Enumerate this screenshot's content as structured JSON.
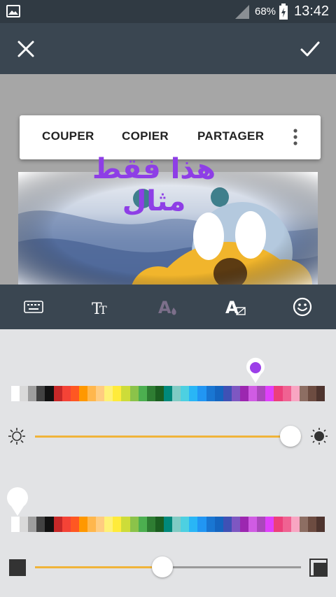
{
  "status_bar": {
    "battery": "68%",
    "time": "13:42",
    "icons": [
      "gallery-icon",
      "signal-icon",
      "battery-charging-icon"
    ]
  },
  "app_bar": {
    "icons": [
      "close-icon",
      "check-icon"
    ]
  },
  "popup_menu": {
    "cut_label": "COUPER",
    "copy_label": "COPIER",
    "share_label": "PARTAGER",
    "more_icon": "more-vert-icon"
  },
  "canvas": {
    "overlay_text": "هذا فقط مثال",
    "overlay_text_color": "#8e3ee6"
  },
  "toolbar": {
    "tools": [
      "keyboard-icon",
      "text-size-icon",
      "text-color-icon",
      "text-background-icon",
      "emoji-icon"
    ]
  },
  "palette": {
    "colors": [
      "#ffffff",
      "#d9d9d9",
      "#9e9e9e",
      "#424242",
      "#111111",
      "#c62828",
      "#f44336",
      "#ff5722",
      "#ff9800",
      "#ffb74d",
      "#ffcc80",
      "#fff176",
      "#ffeb3b",
      "#cddc39",
      "#8bc34a",
      "#4caf50",
      "#2e7d32",
      "#1b5e20",
      "#00897b",
      "#80cbc4",
      "#4dd0e1",
      "#29b6f6",
      "#2196f3",
      "#1976d2",
      "#1565c0",
      "#3f51b5",
      "#7e57c2",
      "#9c27b0",
      "#d05ce3",
      "#ab47bc",
      "#e040fb",
      "#ec407a",
      "#f06292",
      "#f8a5c2",
      "#8d6e63",
      "#6d4c41",
      "#4e342e"
    ],
    "text_color_selected": "#9c3fe8",
    "text_color_position": 0.78,
    "background_color_position": 0.0
  },
  "brightness_slider": {
    "value": 0.96,
    "left_icon": "sun-outline-icon",
    "right_icon": "sun-filled-icon",
    "track_color": "#f0b43a"
  },
  "opacity_slider": {
    "value": 0.48,
    "left_icon": "background-opacity-low-icon",
    "right_icon": "background-opacity-high-icon",
    "track_color": "#f0b43a"
  }
}
